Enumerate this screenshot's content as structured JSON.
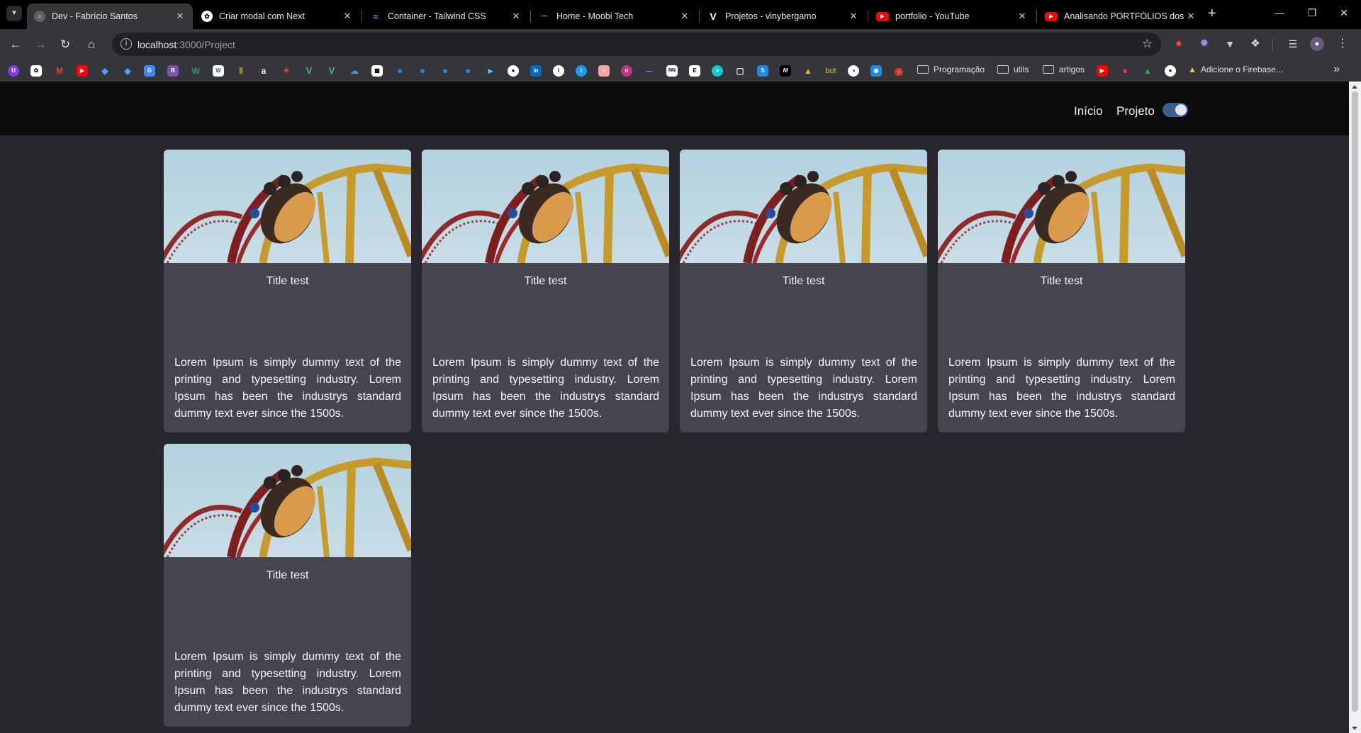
{
  "browser": {
    "tabs": [
      {
        "title": "Dev - Fabrício Santos",
        "active": true,
        "favicon": "globe-icon",
        "color": "#5f6368"
      },
      {
        "title": "Criar modal com Next",
        "active": false,
        "favicon": "chatgpt-icon",
        "color": "#ffffff"
      },
      {
        "title": "Container - Tailwind CSS",
        "active": false,
        "favicon": "tailwind-icon",
        "color": "#38bdf8"
      },
      {
        "title": "Home - Moobi Tech",
        "active": false,
        "favicon": "moobi-icon",
        "color": "#444444"
      },
      {
        "title": "Projetos - vinybergamo",
        "active": false,
        "favicon": "v-logo-icon",
        "color": "#ffffff"
      },
      {
        "title": "portfolio - YouTube",
        "active": false,
        "favicon": "youtube-icon",
        "color": "#ff0000"
      },
      {
        "title": "Analisando PORTFÓLIOS dos In",
        "active": false,
        "favicon": "youtube-icon",
        "color": "#ff0000"
      }
    ],
    "address": {
      "host": "localhost",
      "path": ":3000/Project"
    },
    "bookmark_folders": [
      "Programação",
      "utils",
      "artigos"
    ],
    "bookmark_link": "Adicione o Firebase...",
    "bookmark_bot": "bot"
  },
  "site": {
    "nav": {
      "home": "Início",
      "project": "Projeto"
    },
    "theme_toggle": {
      "on": true,
      "accent": "#3a5e8c"
    }
  },
  "projects": [
    {
      "title": "Title test",
      "description": "Lorem Ipsum is simply dummy text of the printing and typesetting industry. Lorem Ipsum has been the industrys standard dummy text ever since the 1500s."
    },
    {
      "title": "Title test",
      "description": "Lorem Ipsum is simply dummy text of the printing and typesetting industry. Lorem Ipsum has been the industrys standard dummy text ever since the 1500s."
    },
    {
      "title": "Title test",
      "description": "Lorem Ipsum is simply dummy text of the printing and typesetting industry. Lorem Ipsum has been the industrys standard dummy text ever since the 1500s."
    },
    {
      "title": "Title test",
      "description": "Lorem Ipsum is simply dummy text of the printing and typesetting industry. Lorem Ipsum has been the industrys standard dummy text ever since the 1500s."
    },
    {
      "title": "Title test",
      "description": "Lorem Ipsum is simply dummy text of the printing and typesetting industry. Lorem Ipsum has been the industrys standard dummy text ever since the 1500s."
    }
  ]
}
